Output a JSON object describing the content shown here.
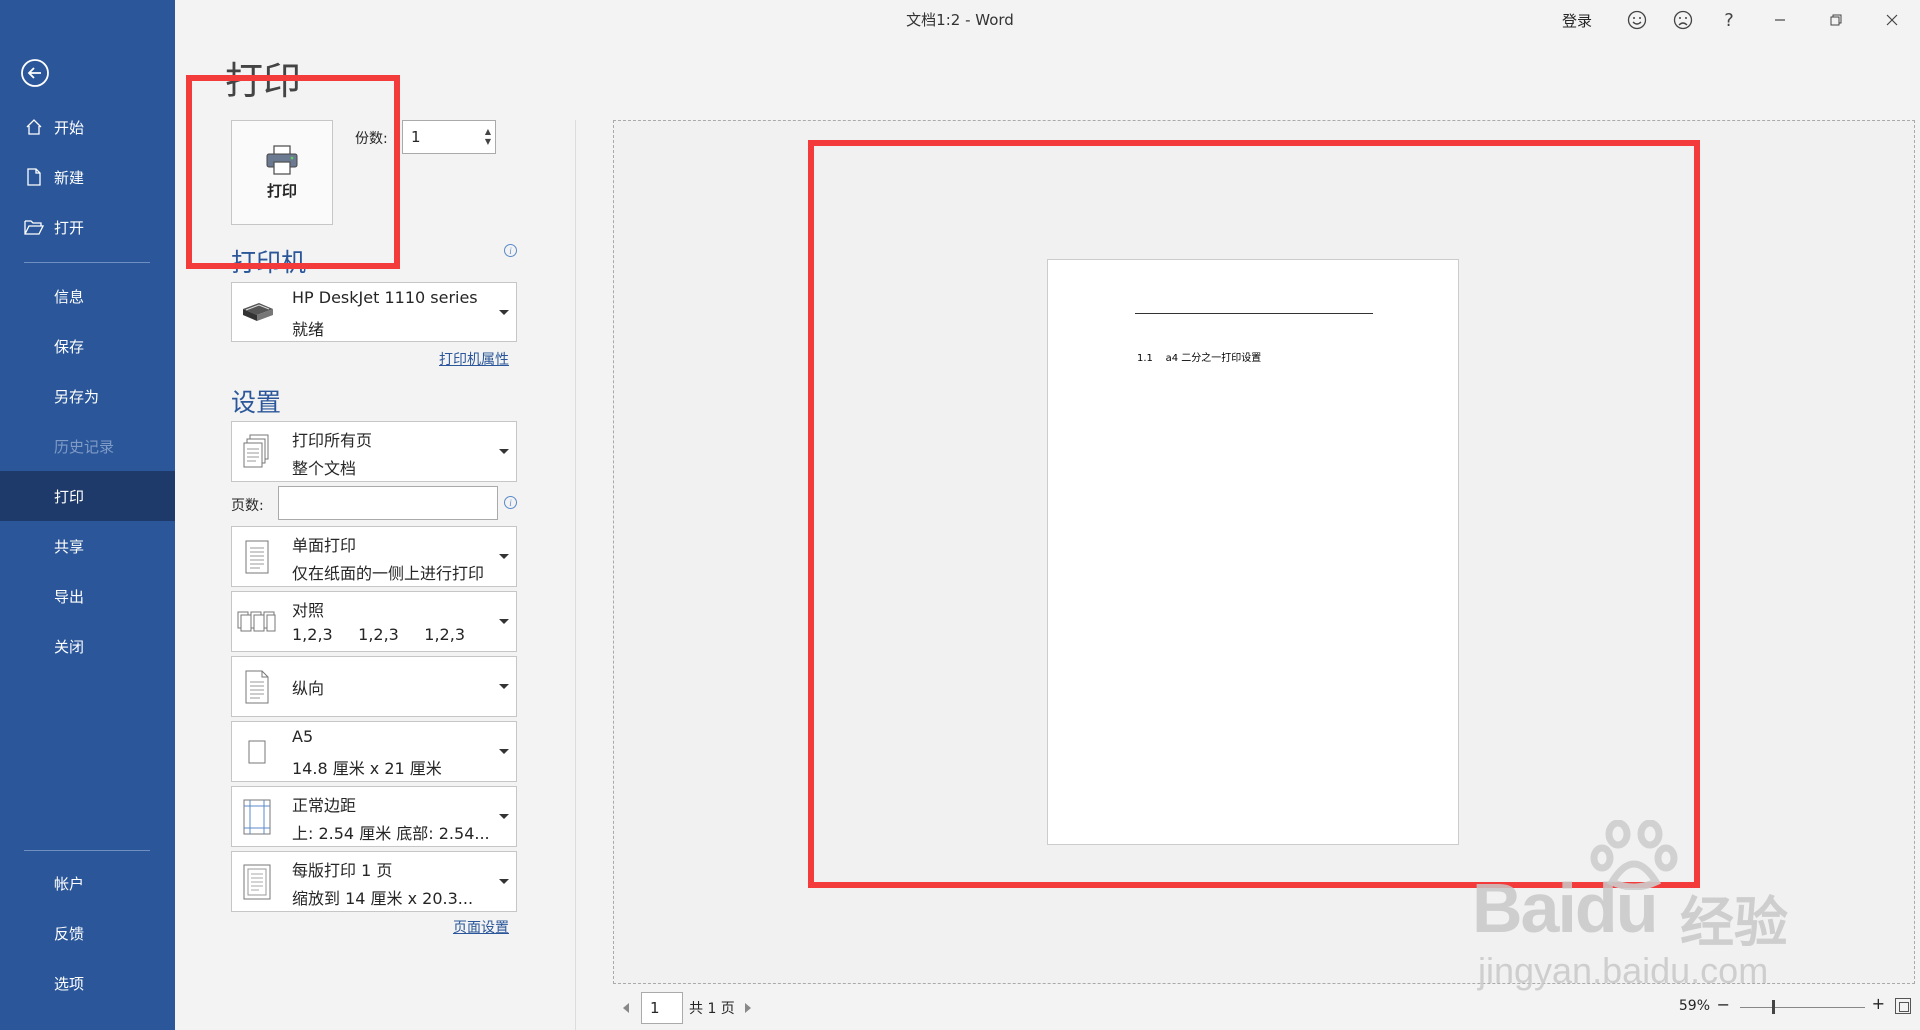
{
  "window": {
    "title": "文档1:2  -  Word",
    "login": "登录",
    "help": "?"
  },
  "sidebar": {
    "items": [
      {
        "label": "开始"
      },
      {
        "label": "新建"
      },
      {
        "label": "打开"
      },
      {
        "label": "信息"
      },
      {
        "label": "保存"
      },
      {
        "label": "另存为"
      },
      {
        "label": "历史记录"
      },
      {
        "label": "打印"
      },
      {
        "label": "共享"
      },
      {
        "label": "导出"
      },
      {
        "label": "关闭"
      },
      {
        "label": "帐户"
      },
      {
        "label": "反馈"
      },
      {
        "label": "选项"
      }
    ],
    "active": "打印",
    "disabled": "历史记录"
  },
  "print": {
    "title": "打印",
    "button_label": "打印",
    "copies_label": "份数:",
    "copies_value": "1"
  },
  "printer": {
    "heading": "打印机",
    "name": "HP DeskJet 1110 series",
    "status": "就绪",
    "properties_link": "打印机属性"
  },
  "settings": {
    "heading": "设置",
    "range": {
      "line1": "打印所有页",
      "line2": "整个文档"
    },
    "pages_label": "页数:",
    "pages_value": "",
    "sides": {
      "line1": "单面打印",
      "line2": "仅在纸面的一侧上进行打印"
    },
    "collate": {
      "line1": "对照",
      "line2": "1,2,3     1,2,3     1,2,3"
    },
    "orientation": {
      "line1": "纵向"
    },
    "paper": {
      "line1": "A5",
      "line2": "14.8 厘米 x 21 厘米"
    },
    "margins": {
      "line1": "正常边距",
      "line2": "上: 2.54 厘米 底部: 2.54..."
    },
    "per_sheet": {
      "line1": "每版打印 1 页",
      "line2": "缩放到 14 厘米 x 20.3..."
    },
    "page_setup_link": "页面设置"
  },
  "preview": {
    "heading_text": "1.1    a4 二分之一打印设置",
    "current_page": "1",
    "total_pages": "共 1 页",
    "zoom": "59%",
    "zoom_minus": "−",
    "zoom_plus": "+"
  },
  "watermark": {
    "brand": "Baidu",
    "brand_cn": "经验",
    "url": "jingyan.baidu.com"
  },
  "colors": {
    "sidebar": "#2b579a",
    "active": "#1e3a6a",
    "highlight": "#f43b3b"
  }
}
